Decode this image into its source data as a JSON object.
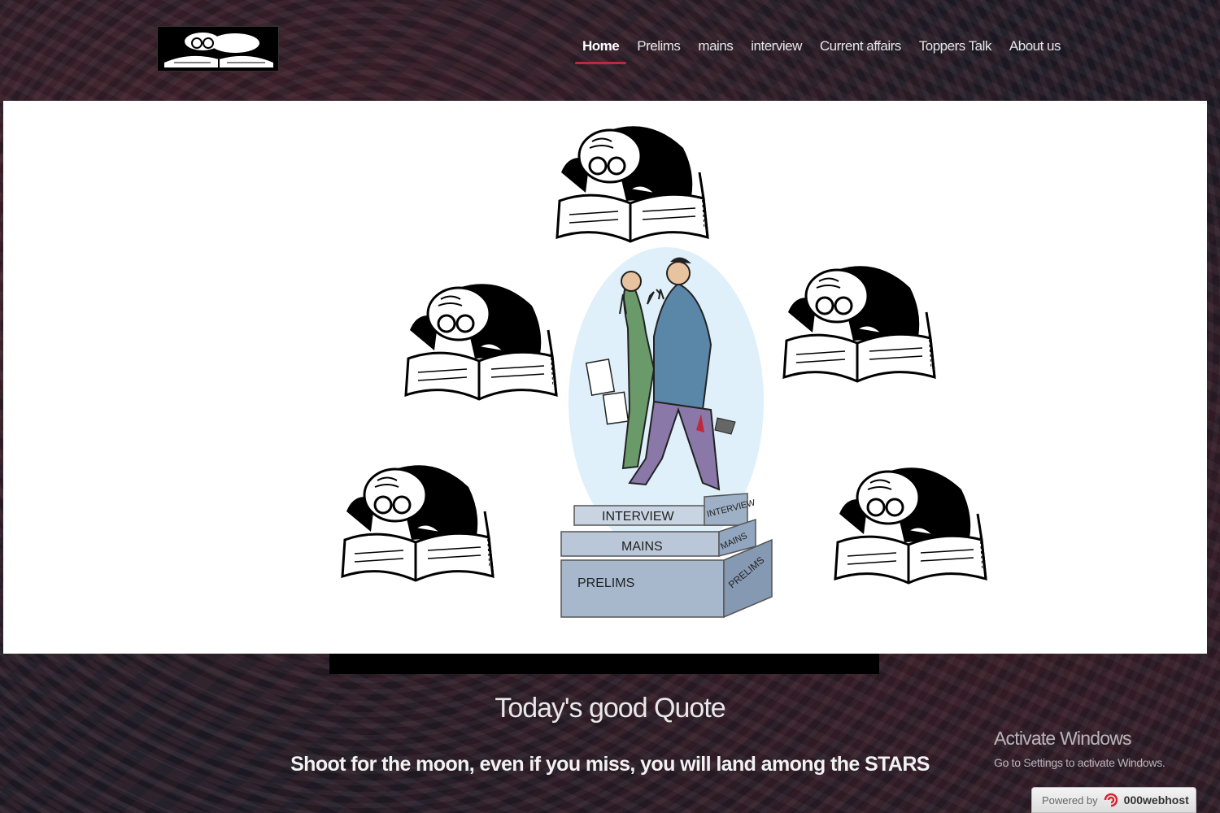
{
  "nav": {
    "items": [
      {
        "label": "Home",
        "active": true
      },
      {
        "label": "Prelims",
        "active": false
      },
      {
        "label": "mains",
        "active": false
      },
      {
        "label": "interview",
        "active": false
      },
      {
        "label": "Current affairs",
        "active": false
      },
      {
        "label": "Toppers Talk",
        "active": false
      },
      {
        "label": "About us",
        "active": false
      }
    ],
    "active_color": "#c0283b"
  },
  "hero": {
    "steps": [
      "INTERVIEW",
      "MAINS",
      "PRELIMS"
    ],
    "side_labels": [
      "INTERVIEW",
      "MAINS",
      "PRELIMS"
    ]
  },
  "quote": {
    "title": "Today's good Quote",
    "text": "Shoot for the moon, even if you miss, you will land among the STARS"
  },
  "watermark": {
    "title": "Activate Windows",
    "subtitle": "Go to Settings to activate Windows."
  },
  "badge": {
    "prefix": "Powered by",
    "brand": "000webhost"
  }
}
